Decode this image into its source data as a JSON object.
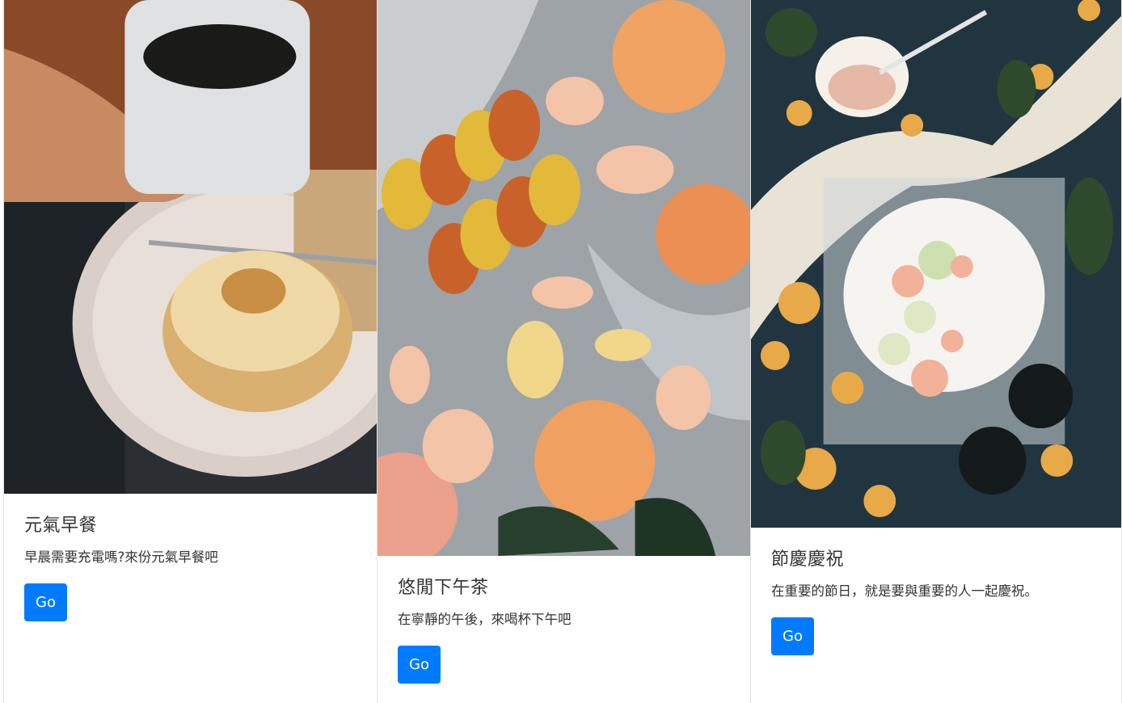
{
  "cards": [
    {
      "title": "元氣早餐",
      "text": "早晨需要充電嗎?來份元氣早餐吧",
      "button": "Go"
    },
    {
      "title": "悠閒下午茶",
      "text": "在寧靜的午後，來喝杯下午吧",
      "button": "Go"
    },
    {
      "title": "節慶慶祝",
      "text": "在重要的節日，就是要與重要的人一起慶祝。",
      "button": "Go"
    }
  ],
  "colors": {
    "button": "#007bff",
    "text": "#212529"
  }
}
